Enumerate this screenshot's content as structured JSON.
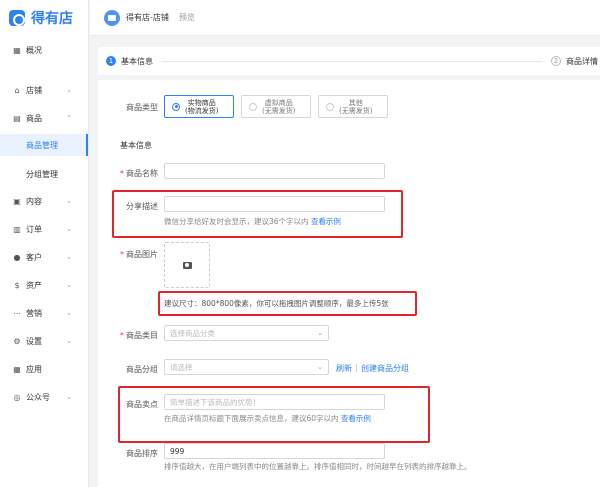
{
  "app": {
    "logo_text": "得有店"
  },
  "topbar": {
    "store_name": "得有店-店铺",
    "preview": "预览"
  },
  "sidebar": {
    "items": [
      {
        "label": "概况",
        "icon": "grid-icon",
        "glyph": "▦"
      },
      {
        "label": "店铺",
        "icon": "store-icon",
        "glyph": "⌂"
      },
      {
        "label": "商品",
        "icon": "goods-icon",
        "glyph": "▤"
      },
      {
        "label": "内容",
        "icon": "content-icon",
        "glyph": "▣"
      },
      {
        "label": "订单",
        "icon": "order-icon",
        "glyph": "▥"
      },
      {
        "label": "客户",
        "icon": "customer-icon",
        "glyph": "●"
      },
      {
        "label": "资产",
        "icon": "asset-icon",
        "glyph": "$"
      },
      {
        "label": "营销",
        "icon": "marketing-icon",
        "glyph": "⋯"
      },
      {
        "label": "设置",
        "icon": "settings-icon",
        "glyph": "⚙"
      },
      {
        "label": "应用",
        "icon": "apps-icon",
        "glyph": "▦"
      },
      {
        "label": "公众号",
        "icon": "wechat-icon",
        "glyph": "◎"
      }
    ],
    "sub_items": [
      {
        "label": "商品管理",
        "active": true
      },
      {
        "label": "分组管理",
        "active": false
      }
    ]
  },
  "steps": {
    "step1": {
      "num": "1",
      "label": "基本信息"
    },
    "step2": {
      "num": "2",
      "label": "商品详情"
    }
  },
  "form": {
    "type_label": "商品类型",
    "types": [
      {
        "line1": "实物商品",
        "line2": "(物流发货)",
        "selected": true
      },
      {
        "line1": "虚拟商品",
        "line2": "(无需发货)",
        "selected": false
      },
      {
        "line1": "其他",
        "line2": "(无需发货)",
        "selected": false
      }
    ],
    "section_title": "基本信息",
    "name_label": "商品名称",
    "share_label": "分享描述",
    "share_hint": "微信分享给好友时会显示，建议36个字以内",
    "share_example": "查看示例",
    "image_label": "商品图片",
    "image_hint": "建议尺寸：800*800像素，你可以拖拽图片调整顺序，最多上传5张",
    "category_label": "商品类目",
    "category_placeholder": "选择商品分类",
    "group_label": "商品分组",
    "group_placeholder": "请选择",
    "refresh": "刷新",
    "separator": "|",
    "create_group": "创建商品分组",
    "selling_label": "商品卖点",
    "selling_placeholder": "简单描述下该商品的优势！",
    "selling_hint": "在商品详情页标题下面展示卖点信息，建议60字以内",
    "selling_example": "查看示例",
    "sort_label": "商品排序",
    "sort_value": "999",
    "sort_hint": "排序值越大，在用户端列表中的位置越靠上。排序值相同时，时间越早在列表的排序越靠上。"
  },
  "colors": {
    "accent": "#2f7ff5",
    "highlight": "#e0262a"
  }
}
